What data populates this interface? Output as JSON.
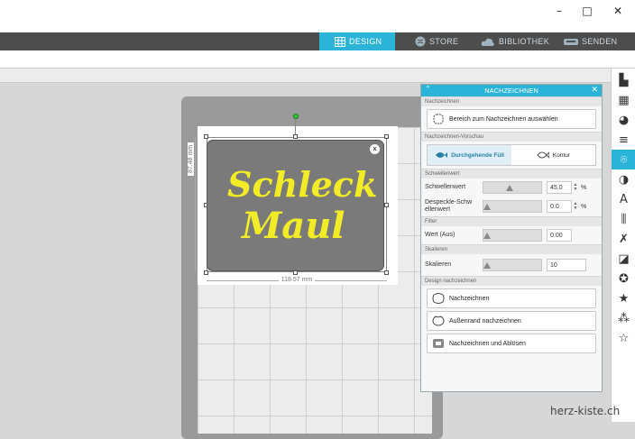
{
  "window": {
    "minimize": "–",
    "maximize": "□",
    "close": "✕"
  },
  "nav": {
    "design": "DESIGN",
    "store": "STORE",
    "library": "BIBLIOTHEK",
    "send": "SENDEN",
    "active": "design"
  },
  "canvas": {
    "width_label": "118.57 mm",
    "height_label": "87.48 mm",
    "artwork_text_line1": "Schleck",
    "artwork_text_line2": "Maul",
    "artwork_color": "#f2ec26"
  },
  "panel": {
    "title": "NACHZEICHNEN",
    "section_trace": "Nachzeichnen",
    "select_area": "Bereich zum Nachzeichnen auswählen",
    "section_preview": "Nachzeichnen-Vorschau",
    "fill_option": "Durchgehende Füll",
    "outline_option": "Kontur",
    "section_threshold": "Schwellenwert",
    "threshold_label": "Schwellenwert",
    "threshold_value": "45.0",
    "threshold_unit": "%",
    "threshold_level": 0.45,
    "despeckle_label_1": "Despeckle-Schw",
    "despeckle_label_2": "ellenwert",
    "despeckle_value": "0.0",
    "despeckle_unit": "%",
    "despeckle_level": 0.0,
    "section_filter": "Filter",
    "filter_label": "Wert (Aus)",
    "filter_value": "0.00",
    "filter_level": 0.0,
    "section_scale": "Skalieren",
    "scale_label": "Skalieren",
    "scale_value": "10",
    "scale_level": 0.0,
    "section_design": "Design nachzeichnen",
    "btn_trace": "Nachzeichnen",
    "btn_outer": "Außenrand nachzeichnen",
    "btn_detach": "Nachzeichnen und Ablösen"
  },
  "colors": {
    "accent": "#2bb4d8",
    "navbar": "#4d4d4d"
  },
  "sidebar_icons": [
    "page-setup-icon",
    "image-icon",
    "palette-icon",
    "line-style-icon",
    "trace-icon",
    "fill-icon",
    "text-icon",
    "align-icon",
    "transform-icon",
    "modify-icon",
    "replicate-icon",
    "offset-icon",
    "sketch-icon",
    "star-icon"
  ],
  "watermark": "herz-kiste.ch"
}
